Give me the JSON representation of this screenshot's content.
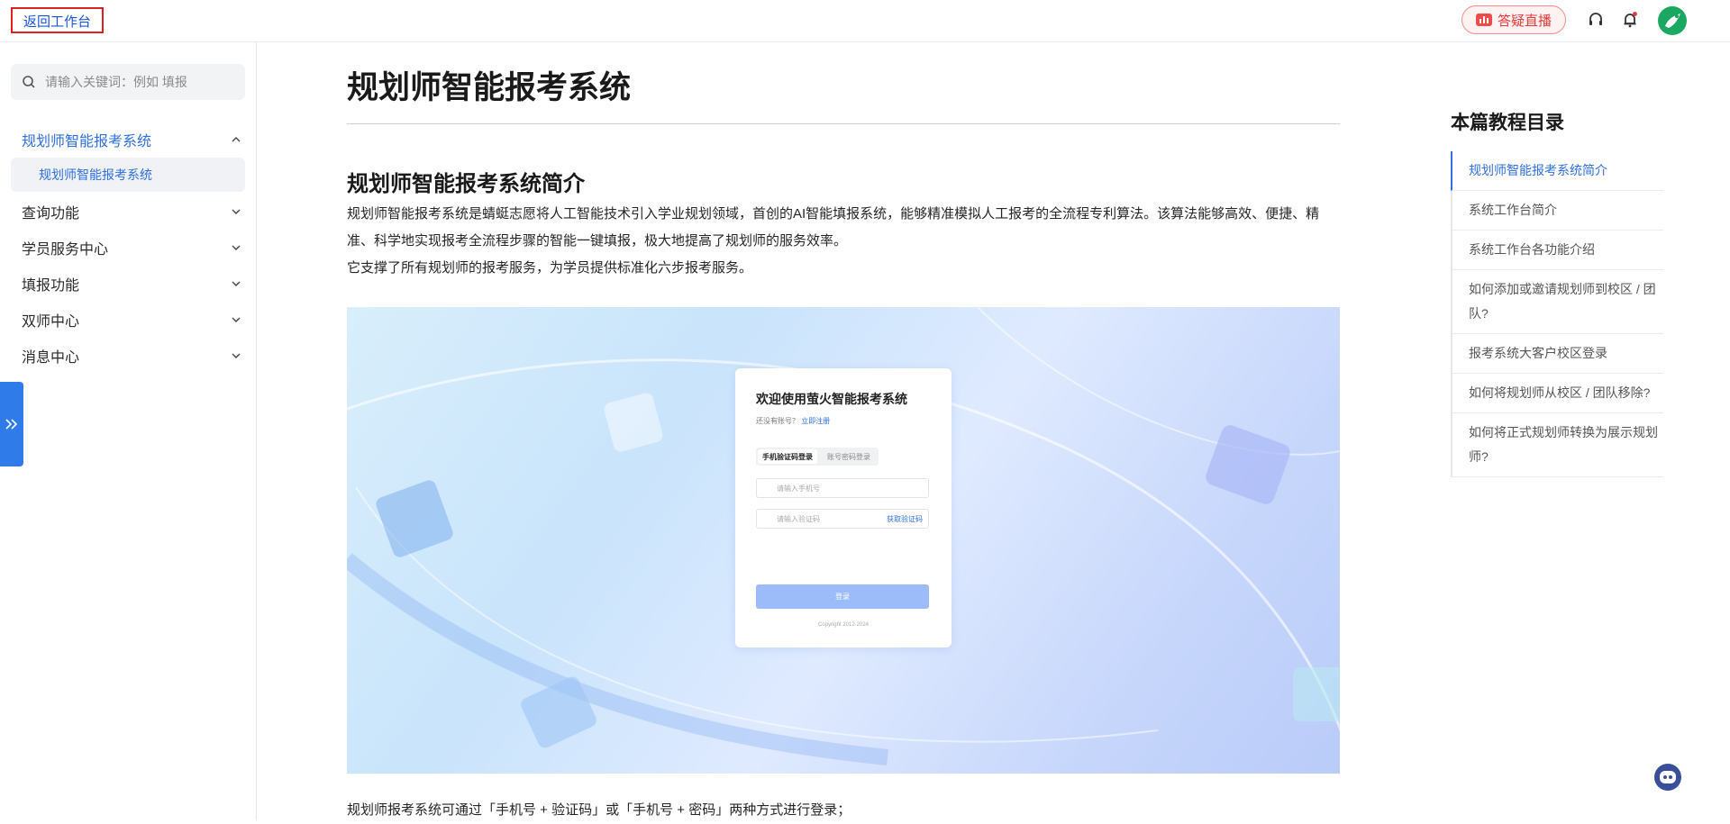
{
  "topbar": {
    "back_label": "返回工作台",
    "live_label": "答疑直播",
    "icons": [
      "headset-icon",
      "bell-icon",
      "avatar"
    ]
  },
  "sidebar": {
    "search_placeholder": "请输入关键词：例如 填报",
    "items": [
      {
        "label": "规划师智能报考系统",
        "expanded": true
      },
      {
        "label": "查询功能",
        "expanded": false
      },
      {
        "label": "学员服务中心",
        "expanded": false
      },
      {
        "label": "填报功能",
        "expanded": false
      },
      {
        "label": "双师中心",
        "expanded": false
      },
      {
        "label": "消息中心",
        "expanded": false
      }
    ],
    "sub_item": "规划师智能报考系统"
  },
  "main": {
    "title": "规划师智能报考系统",
    "section_title": "规划师智能报考系统简介",
    "intro_1": "规划师智能报考系统是蜻蜓志愿将人工智能技术引入学业规划领域，首创的AI智能填报系统，能够精准模拟人工报考的全流程专利算法。该算法能够高效、便捷、精准、科学地实现报考全流程步骤的智能一键填报，极大地提高了规划师的服务效率。",
    "intro_2": "它支撑了所有规划师的报考服务，为学员提供标准化六步报考服务。",
    "login_note": "规划师报考系统可通过「手机号 + 验证码」或「手机号 + 密码」两种方式进行登录；"
  },
  "figure": {
    "title": "欢迎使用萤火智能报考系统",
    "sub_text": "还没有账号？",
    "sub_link": "立即注册",
    "tab_1": "手机验证码登录",
    "tab_2": "账号密码登录",
    "phone_placeholder": "请输入手机号",
    "code_placeholder": "请输入验证码",
    "get_code": "获取验证码",
    "login_btn": "登录",
    "copyright": "Copyright 2012-2024"
  },
  "toc": {
    "title": "本篇教程目录",
    "items": [
      "规划师智能报考系统简介",
      "系统工作台简介",
      "系统工作台各功能介绍",
      "如何添加或邀请规划师到校区 / 团队?",
      "报考系统大客户校区登录",
      "如何将规划师从校区 / 团队移除?",
      "如何将正式规划师转换为展示规划师?"
    ],
    "active_index": 0
  },
  "colors": {
    "accent": "#2f6fe0",
    "live": "#e03c3c",
    "tab": "#2f7be9"
  }
}
